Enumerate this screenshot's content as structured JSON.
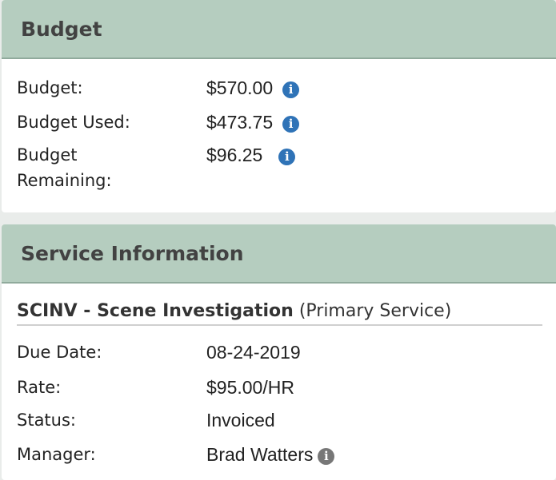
{
  "budget_panel": {
    "title": "Budget",
    "rows": [
      {
        "label": "Budget:",
        "value": "$570.00"
      },
      {
        "label": "Budget Used:",
        "value": "$473.75"
      },
      {
        "label": "Budget Remaining:",
        "value": "$96.25"
      }
    ]
  },
  "service_panel": {
    "title": "Service Information",
    "service_name": "SCINV - Scene Investigation",
    "service_note": "(Primary Service)",
    "rows": [
      {
        "label": "Due Date:",
        "value": "08-24-2019"
      },
      {
        "label": "Rate:",
        "value": "$95.00/HR"
      },
      {
        "label": "Status:",
        "value": "Invoiced"
      },
      {
        "label": "Manager:",
        "value": "Brad Watters"
      }
    ]
  },
  "icons": {
    "info_glyph": "i",
    "info_color": "#2f73b7",
    "info_grey_color": "#777777"
  },
  "colors": {
    "header_bg": "#b5cdbf",
    "page_bg": "#e9ecea"
  }
}
